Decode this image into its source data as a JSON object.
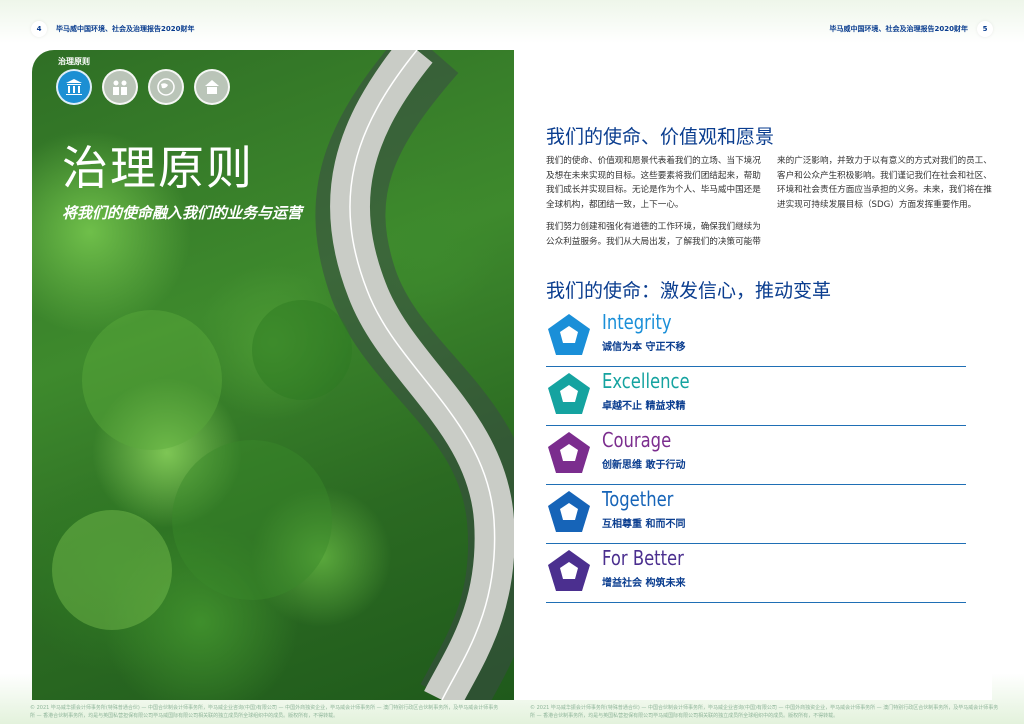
{
  "header": {
    "left_page_number": "4",
    "right_page_number": "5",
    "title_left": "毕马威中国环境、社会及治理报告2020财年",
    "title_right": "毕马威中国环境、社会及治理报告2020财年"
  },
  "left": {
    "section_tag": "治理原则",
    "icons": [
      "governance-pillars-icon",
      "people-icon",
      "globe-icon",
      "community-icon"
    ],
    "title": "治理原则",
    "subtitle": "将我们的使命融入我们的业务与运营"
  },
  "right": {
    "vision_heading": "我们的使命、价值观和愿景",
    "vision_col1_p1": "我们的使命、价值观和愿景代表着我们的立场、当下境况及想在未来实现的目标。这些要素将我们团结起来，帮助我们成长并实现目标。无论是作为个人、毕马威中国还是全球机构，都团结一致，上下一心。",
    "vision_col1_p2": "我们努力创建和强化有道德的工作环境，确保我们继续为公众利益服务。我们从大局出发，了解我们的决策可能带",
    "vision_col2_p1": "来的广泛影响，并致力于以有意义的方式对我们的员工、客户和公众产生积极影响。我们谨记我们在社会和社区、环境和社会责任方面应当承担的义务。未来，我们将在推进实现可持续发展目标（SDG）方面发挥重要作用。",
    "mission_heading": "我们的使命：激发信心，推动变革",
    "values": [
      {
        "en": "Integrity",
        "cn": "诚信为本 守正不移",
        "color": "#1a8fd8"
      },
      {
        "en": "Excellence",
        "cn": "卓越不止 精益求精",
        "color": "#15a3a0"
      },
      {
        "en": "Courage",
        "cn": "创新思维 敢于行动",
        "color": "#7b2d8e"
      },
      {
        "en": "Together",
        "cn": "互相尊重 和而不同",
        "color": "#1664b8"
      },
      {
        "en": "For Better",
        "cn": "增益社会 构筑未来",
        "color": "#4b2f8f"
      }
    ]
  },
  "footer": {
    "left_text": "© 2021 毕马威华振会计师事务所(特殊普通合伙) — 中国合伙制会计师事务所，毕马威企业咨询(中国)有限公司 — 中国外商独资企业，毕马威会计师事务所 — 澳门特别行政区合伙制事务所，及毕马威会计师事务所 — 香港合伙制事务所，均是与英国私营担保有限公司毕马威国际有限公司相关联的独立成员所全球组织中的成员。版权所有，不得转载。",
    "right_text": "© 2021 毕马威华振会计师事务所(特殊普通合伙) — 中国合伙制会计师事务所，毕马威企业咨询(中国)有限公司 — 中国外商独资企业，毕马威会计师事务所 — 澳门特别行政区合伙制事务所，及毕马威会计师事务所 — 香港合伙制事务所，均是与英国私营担保有限公司毕马威国际有限公司相关联的独立成员所全球组织中的成员。版权所有，不得转载。"
  }
}
